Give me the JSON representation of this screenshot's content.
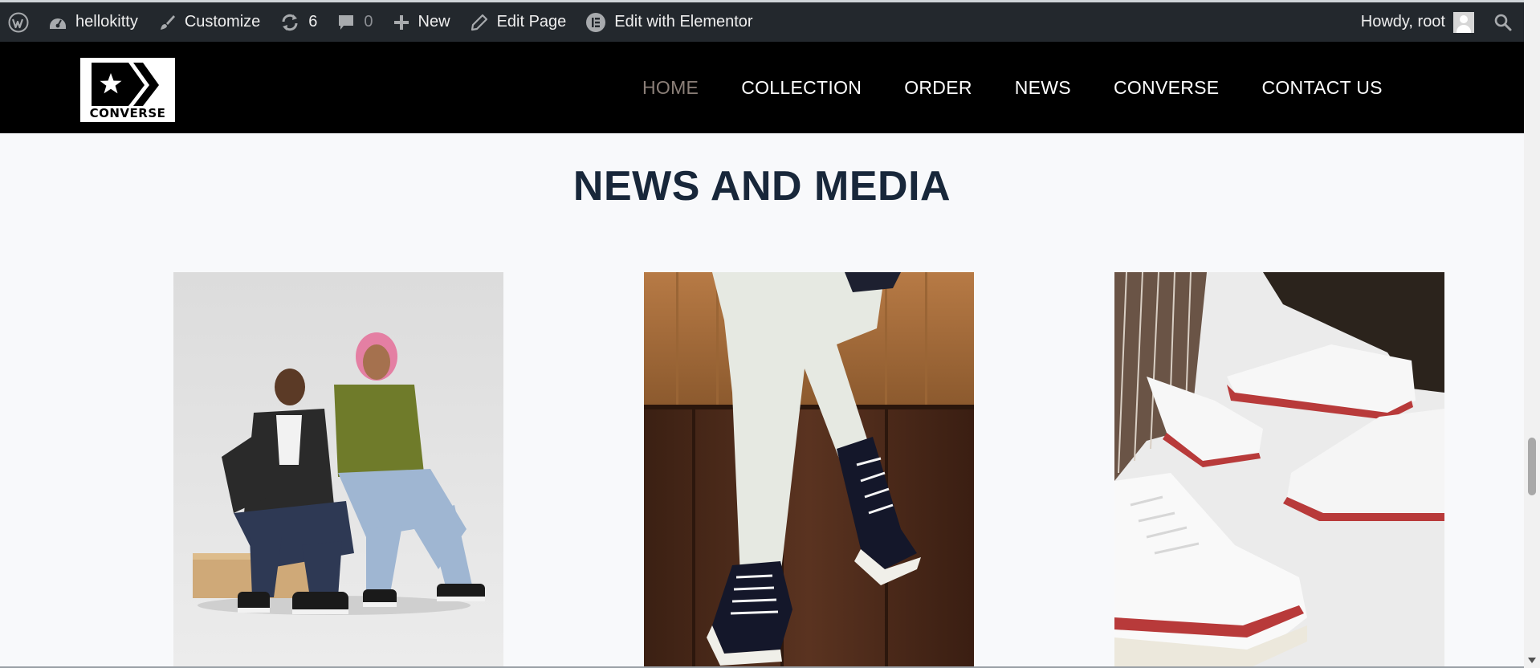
{
  "admin_bar": {
    "site_name": "hellokitty",
    "customize_label": "Customize",
    "updates_count": "6",
    "comments_count": "0",
    "new_label": "New",
    "edit_page_label": "Edit Page",
    "elementor_label": "Edit with Elementor",
    "greeting": "Howdy, root",
    "icons": [
      "wordpress-logo-icon",
      "dashboard-icon",
      "brush-icon",
      "updates-icon",
      "comment-icon",
      "plus-icon",
      "pencil-icon",
      "elementor-icon",
      "search-icon"
    ]
  },
  "header": {
    "logo_text": "CONVERSE",
    "nav": [
      {
        "label": "HOME",
        "active": true
      },
      {
        "label": "COLLECTION",
        "active": false
      },
      {
        "label": "ORDER",
        "active": false
      },
      {
        "label": "NEWS",
        "active": false
      },
      {
        "label": "CONVERSE",
        "active": false
      },
      {
        "label": "CONTACT US",
        "active": false
      }
    ]
  },
  "main": {
    "heading": "NEWS AND MEDIA"
  },
  "colors": {
    "admin_bar_bg": "#23282d",
    "header_bg": "#000000",
    "nav_active": "#8b7f78",
    "heading": "#18273a",
    "page_bg": "#f8f9fb"
  }
}
